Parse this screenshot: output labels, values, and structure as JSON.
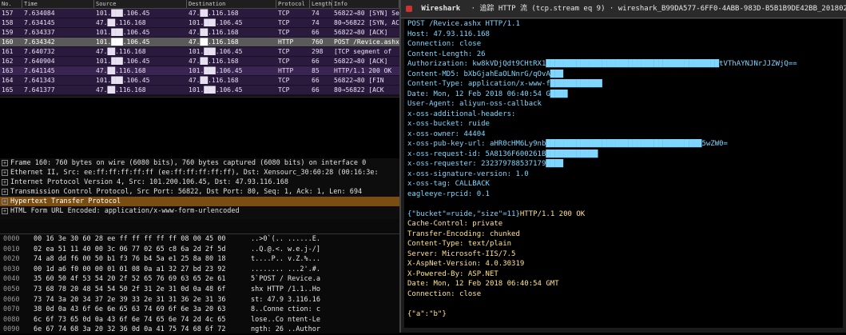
{
  "packet_list": {
    "columns": [
      "No.",
      "Time",
      "Source",
      "Destination",
      "Protocol",
      "Length",
      "Info"
    ],
    "rows": [
      {
        "no": "157",
        "time": "7.634084",
        "src": "101.███.106.45",
        "dst": "47.██.116.168",
        "proto": "TCP",
        "len": "74",
        "info": "56822→80 [SYN] Seq=0 Win=14600 Len=0 MSS=1460 SACK_PERM=1 TSval=2704418748 TSecr=0 WS=512"
      },
      {
        "no": "158",
        "time": "7.634145",
        "src": "47.██.116.168",
        "dst": "101.███.106.45",
        "proto": "TCP",
        "len": "74",
        "info": "80→56822 [SYN, ACK]"
      },
      {
        "no": "159",
        "time": "7.634337",
        "src": "101.███.106.45",
        "dst": "47.██.116.168",
        "proto": "TCP",
        "len": "66",
        "info": "56822→80 [ACK]"
      },
      {
        "no": "160",
        "time": "7.634342",
        "src": "101.███.106.45",
        "dst": "47.██.116.168",
        "proto": "HTTP",
        "len": "760",
        "info": "POST /Revice.ashx"
      },
      {
        "no": "161",
        "time": "7.640732",
        "src": "47.██.116.168",
        "dst": "101.███.106.45",
        "proto": "TCP",
        "len": "298",
        "info": "[TCP segment of"
      },
      {
        "no": "162",
        "time": "7.640904",
        "src": "101.███.106.45",
        "dst": "47.██.116.168",
        "proto": "TCP",
        "len": "66",
        "info": "56822→80 [ACK]"
      },
      {
        "no": "163",
        "time": "7.641145",
        "src": "47.██.116.168",
        "dst": "101.███.106.45",
        "proto": "HTTP",
        "len": "85",
        "info": "HTTP/1.1 200 OK"
      },
      {
        "no": "164",
        "time": "7.641343",
        "src": "101.███.106.45",
        "dst": "47.██.116.168",
        "proto": "TCP",
        "len": "66",
        "info": "56822→80 [FIN"
      },
      {
        "no": "165",
        "time": "7.641377",
        "src": "47.██.116.168",
        "dst": "101.███.106.45",
        "proto": "TCP",
        "len": "66",
        "info": "80→56822 [ACK"
      }
    ]
  },
  "details": [
    {
      "text": "Frame 160: 760 bytes on wire (6080 bits), 760 bytes captured (6080 bits) on interface 0",
      "highlight": false
    },
    {
      "text": "Ethernet II, Src: ee:ff:ff:ff:ff:ff (ee:ff:ff:ff:ff:ff), Dst: Xensourc_30:60:28 (00:16:3e:",
      "highlight": false
    },
    {
      "text": "Internet Protocol Version 4, Src: 101.200.106.45, Dst: 47.93.116.168",
      "highlight": false
    },
    {
      "text": "Transmission Control Protocol, Src Port: 56822, Dst Port: 80, Seq: 1, Ack: 1, Len: 694",
      "highlight": false
    },
    {
      "text": "Hypertext Transfer Protocol",
      "highlight": true
    },
    {
      "text": "HTML Form URL Encoded: application/x-www-form-urlencoded",
      "highlight": false
    }
  ],
  "hex": [
    {
      "off": "0000",
      "bytes": "00 16 3e 30 60 28 ee ff  ff ff ff ff 08 00 45 00",
      "ascii": "..>0`(.. ......E."
    },
    {
      "off": "0010",
      "bytes": "02 ea 51 11 40 00 3c 06  77 02 65 c8 6a 2d 2f 5d",
      "ascii": "..Q.@.<. w.e.j-/]"
    },
    {
      "off": "0020",
      "bytes": "74 a8 dd f6 00 50 b1 f3  76 b4 5a e1 25 8a 80 18",
      "ascii": "t....P.. v.Z.%..."
    },
    {
      "off": "0030",
      "bytes": "00 1d a6 f0 00 00 01 01  08 0a a1 32 27 bd 23 92",
      "ascii": "........ ...2'.#."
    },
    {
      "off": "0040",
      "bytes": "35 60 50 4f 53 54 20 2f  52 65 76 69 63 65 2e 61",
      "ascii": "5`POST / Revice.a"
    },
    {
      "off": "0050",
      "bytes": "73 68 78 20 48 54 54 50  2f 31 2e 31 0d 0a 48 6f",
      "ascii": "shx HTTP /1.1..Ho"
    },
    {
      "off": "0060",
      "bytes": "73 74 3a 20 34 37 2e 39  33 2e 31 31 36 2e 31 36",
      "ascii": "st: 47.9 3.116.16"
    },
    {
      "off": "0070",
      "bytes": "38 0d 0a 43 6f 6e 6e 65  63 74 69 6f 6e 3a 20 63",
      "ascii": "8..Conne ction: c"
    },
    {
      "off": "0080",
      "bytes": "6c 6f 73 65 0d 0a 43 6f  6e 74 65 6e 74 2d 4c 65",
      "ascii": "lose..Co ntent-Le"
    },
    {
      "off": "0090",
      "bytes": "6e 67 74 68 3a 20 32 36  0d 0a 41 75 74 68 6f 72",
      "ascii": "ngth: 26 ..Author"
    }
  ],
  "follow_window": {
    "app": "Wireshark",
    "title": "· 追踪 HTTP 流 (tcp.stream eq 9) · wireshark_B99DA577-6FF0-4ABB-983D-B5B1B9DE42BB_20180212144047_a11000"
  },
  "stream": {
    "request": [
      "POST /Revice.ashx HTTP/1.1",
      "Host: 47.93.116.168",
      "Connection: close",
      "Content-Length: 26",
      "Authorization: kw8kVDjQdt9CHtRX1████████████████████████████████████████tVThAYNJNrJJZWjQ==",
      "Content-MD5: bXbGjahEaOLNnrG/qOvA███",
      "Content-Type: application/x-www-f████████████",
      "Date: Mon, 12 Feb 2018 06:40:54 G████",
      "User-Agent: aliyun-oss-callback",
      "x-oss-additional-headers:",
      "x-oss-bucket: ruide",
      "x-oss-owner: 44404",
      "x-oss-pub-key-url: aHR0cHM6Ly9nb████████████████████████████████████5wZW0=",
      "x-oss-request-id: 5A8136F600261B████████████",
      "x-oss-requester: 232379788537179████",
      "x-oss-signature-version: 1.0",
      "x-oss-tag: CALLBACK",
      "eagleeye-rpcid: 0.1"
    ],
    "body_line": "{\"bucket\"=ruide,\"size\"=11}",
    "response_first": "HTTP/1.1 200 OK",
    "response": [
      "Cache-Control: private",
      "Transfer-Encoding: chunked",
      "Content-Type: text/plain",
      "Server: Microsoft-IIS/7.5",
      "X-AspNet-Version: 4.0.30319",
      "X-Powered-By: ASP.NET",
      "Date: Mon, 12 Feb 2018 06:40:54 GMT",
      "Connection: close"
    ],
    "response_body": "{\"a\":\"b\"}"
  },
  "colors": {
    "request": "#7fd7ff",
    "response": "#ffe38a",
    "highlight": "#7a4e12",
    "tcp_row": "#2a1a3e"
  }
}
